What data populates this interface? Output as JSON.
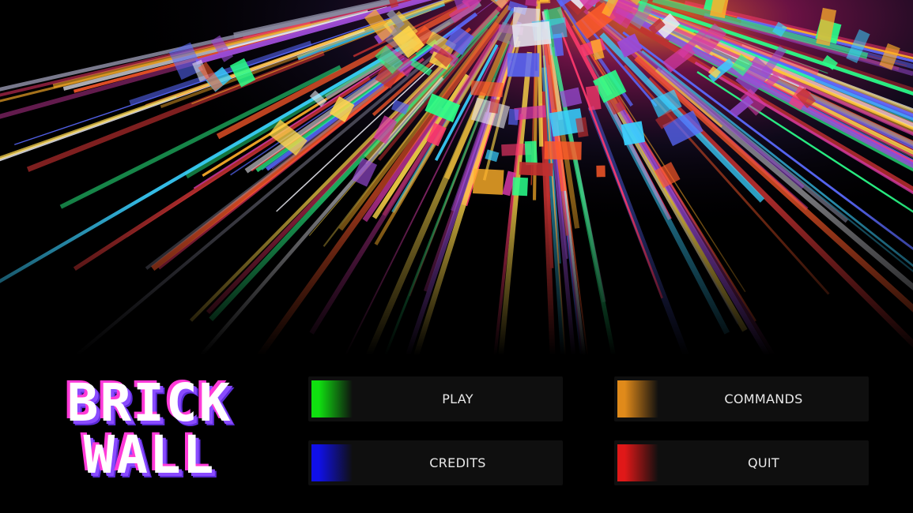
{
  "game": {
    "title_line_1": "BRICK",
    "title_line_2": "WALL"
  },
  "menu": {
    "play": {
      "label": "PLAY",
      "accent": "#10e010"
    },
    "commands": {
      "label": "COMMANDS",
      "accent": "#e08a1a"
    },
    "credits": {
      "label": "CREDITS",
      "accent": "#1010e8"
    },
    "quit": {
      "label": "QUIT",
      "accent": "#e01818"
    }
  },
  "palette": {
    "background": "#000000",
    "button_bg": "#0f0f0f",
    "button_text": "#e8e8e8",
    "logo_fill": "#ffffff",
    "logo_shadow_pink": "#ff3ad8",
    "logo_shadow_purple": "#8a4bff"
  }
}
